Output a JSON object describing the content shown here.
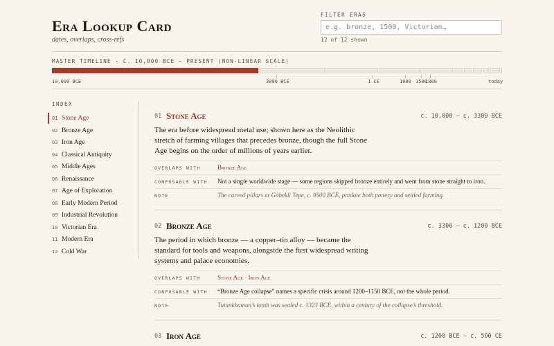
{
  "header": {
    "title": "Era Lookup Card",
    "subtitle": "dates, overlaps, cross-refs",
    "filter_label": "FILTER ERAS",
    "filter_placeholder": "e.g. bronze, 1500, Victorian…",
    "filter_value": "",
    "shown_count": "12 of 12 shown"
  },
  "timeline": {
    "label": "MASTER TIMELINE · C. 10,000 BCE – PRESENT (NON-LINEAR SCALE)",
    "active_segment": "Stone Age",
    "ticks": [
      "10,000 BCE",
      "3000 BCE",
      "1 CE",
      "1000",
      "1500",
      "1800",
      "today"
    ]
  },
  "index": {
    "heading": "INDEX",
    "active": "01",
    "items": [
      {
        "num": "01",
        "name": "Stone Age"
      },
      {
        "num": "02",
        "name": "Bronze Age"
      },
      {
        "num": "03",
        "name": "Iron Age"
      },
      {
        "num": "04",
        "name": "Classical Antiquity"
      },
      {
        "num": "05",
        "name": "Middle Ages"
      },
      {
        "num": "06",
        "name": "Renaissance"
      },
      {
        "num": "07",
        "name": "Age of Exploration"
      },
      {
        "num": "08",
        "name": "Early Modern Period"
      },
      {
        "num": "09",
        "name": "Industrial Revolution"
      },
      {
        "num": "10",
        "name": "Victorian Era"
      },
      {
        "num": "11",
        "name": "Modern Era"
      },
      {
        "num": "12",
        "name": "Cold War"
      }
    ]
  },
  "labels": {
    "overlaps": "OVERLAPS WITH",
    "confusable": "CONFUSABLE WITH",
    "note": "NOTE"
  },
  "entries": [
    {
      "num": "01",
      "title": "Stone Age",
      "range": "c. 10,000 – c. 3300 BCE",
      "description": "The era before widespread metal use; shown here as the Neolithic stretch of farming villages that precedes bronze, though the full Stone Age begins on the order of millions of years earlier.",
      "overlaps": [
        "Bronze Age"
      ],
      "confusable": "Not a single worldwide stage — some regions skipped bronze entirely and went from stone straight to iron.",
      "note": "The carved pillars at Göbekli Tepe, c. 9500 BCE, predate both pottery and settled farming."
    },
    {
      "num": "02",
      "title": "Bronze Age",
      "range": "c. 3300 – c. 1200 BCE",
      "description": "The period in which bronze — a copper–tin alloy — became the standard for tools and weapons, alongside the first widespread writing systems and palace economies.",
      "overlaps": [
        "Stone Age",
        "Iron Age"
      ],
      "confusable": "“Bronze Age collapse” names a specific crisis around 1200–1150 BCE, not the whole period.",
      "note": "Tutankhamun’s tomb was sealed c. 1323 BCE, within a century of the collapse’s threshold."
    },
    {
      "num": "03",
      "title": "Iron Age",
      "range": "c. 1200 BCE – c. 500 CE"
    }
  ],
  "colors": {
    "accent": "#a23b2c",
    "background": "#f8f5ef",
    "text": "#1f1c18",
    "muted": "#6b665e",
    "rule": "#d9d3c7"
  }
}
